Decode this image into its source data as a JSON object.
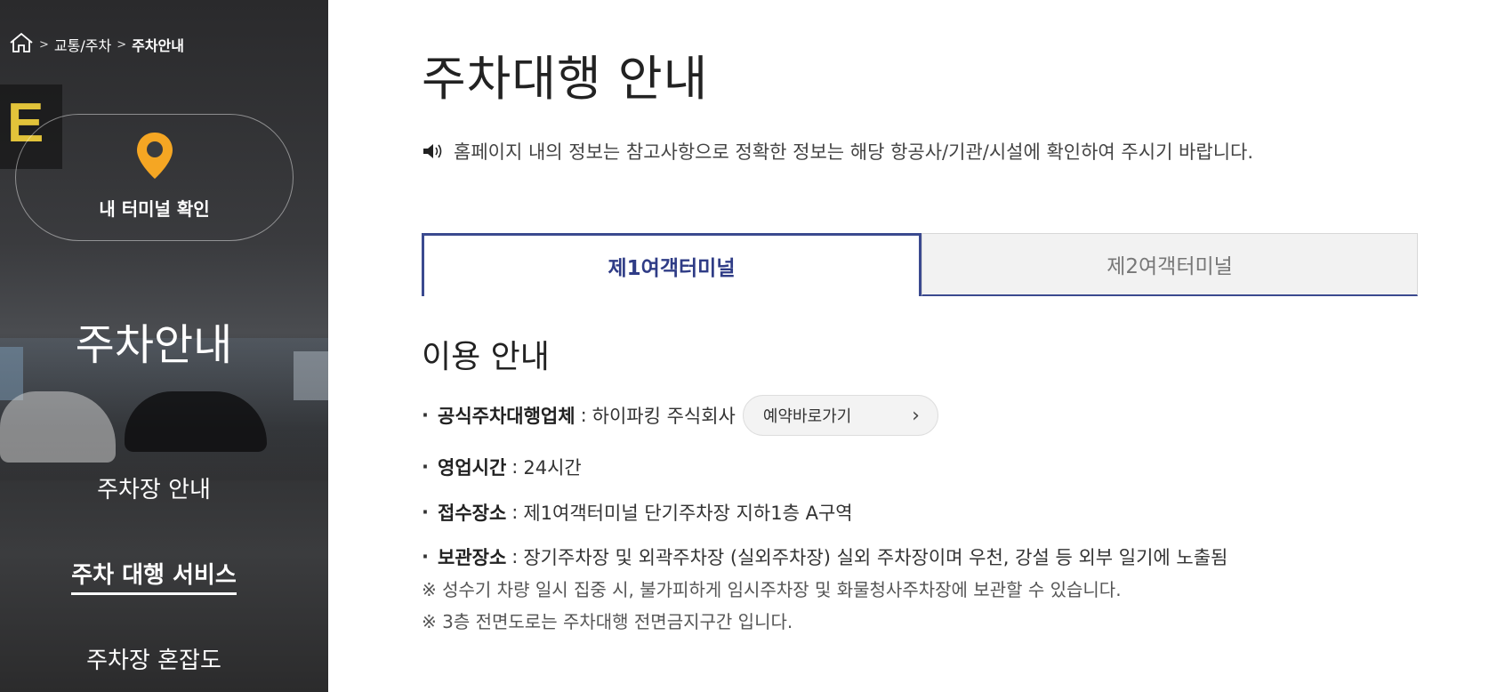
{
  "breadcrumb": {
    "home_icon": "home-icon",
    "items": [
      "교통/주차",
      "주차안내"
    ]
  },
  "sidebar": {
    "terminal_check_label": "내 터미널 확인",
    "title": "주차안내",
    "nav": [
      {
        "label": "주차장 안내",
        "active": false
      },
      {
        "label": "주차 대행 서비스",
        "active": true
      },
      {
        "label": "주차장 혼잡도",
        "active": false
      }
    ],
    "pin_color": "#f5a623"
  },
  "main": {
    "title": "주차대행 안내",
    "notice": "홈페이지 내의 정보는 참고사항으로 정확한 정보는 해당 항공사/기관/시설에 확인하여 주시기 바랍니다.",
    "tabs": [
      {
        "label": "제1여객터미널",
        "active": true
      },
      {
        "label": "제2여객터미널",
        "active": false
      }
    ],
    "section_title": "이용 안내",
    "info": [
      {
        "key": "공식주차대행업체",
        "value": "하이파킹 주식회사"
      },
      {
        "key": "영업시간",
        "value": "24시간"
      },
      {
        "key": "접수장소",
        "value": "제1여객터미널 단기주차장 지하1층 A구역"
      },
      {
        "key": "보관장소",
        "value": "장기주차장 및 외곽주차장 (실외주차장) 실외 주차장이며 우천, 강설 등 외부 일기에 노출됨"
      }
    ],
    "reserve_button": "예약바로가기",
    "notes": [
      "※ 성수기 차량 일시 집중 시, 불가피하게 임시주차장 및 화물청사주차장에 보관할 수 있습니다.",
      "※ 3층 전면도로는 주차대행 전면금지구간 입니다."
    ],
    "accent_color": "#3b4a8f"
  }
}
